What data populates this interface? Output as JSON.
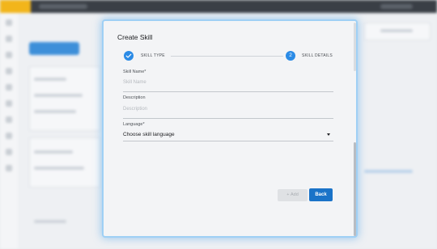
{
  "dialog": {
    "title": "Create Skill",
    "stepper": {
      "steps": [
        {
          "number": "",
          "label": "SKILL TYPE",
          "icon": "check-icon",
          "status": "completed"
        },
        {
          "number": "2",
          "label": "SKILL DETAILS",
          "status": "active"
        }
      ]
    },
    "fields": {
      "skill_name": {
        "label": "Skill Name*",
        "placeholder": "Skill Name"
      },
      "description": {
        "label": "Description",
        "placeholder": "Description"
      },
      "language": {
        "label": "Language*",
        "value": "Choose skill language"
      }
    },
    "buttons": {
      "add_icon": "+",
      "add_label": "Add",
      "back_label": "Back"
    }
  },
  "colors": {
    "accent": "#2b8be6",
    "primary_button": "#1a73c8",
    "disabled_button": "#dfe1e4",
    "modal_glow": "#9fd0f5"
  }
}
